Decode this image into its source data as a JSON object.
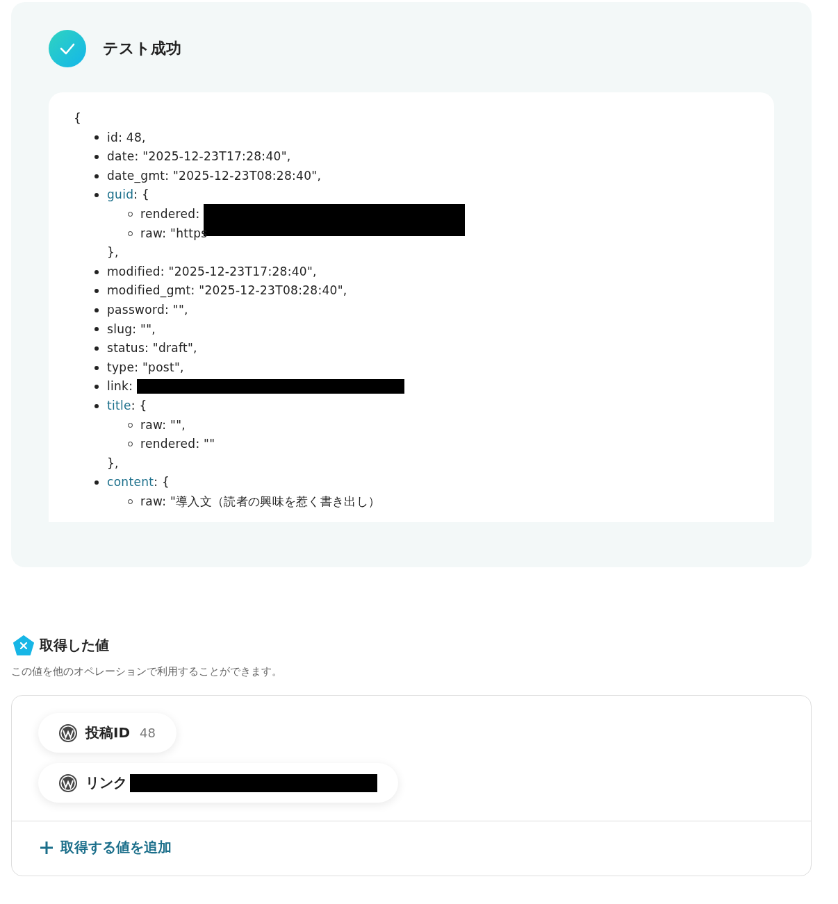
{
  "test_result": {
    "title": "テスト成功",
    "response": {
      "open": "{",
      "items": [
        {
          "key": "id",
          "value": ": 48,"
        },
        {
          "key": "date",
          "value": ": \"2025-12-23T17:28:40\","
        },
        {
          "key": "date_gmt",
          "value": ": \"2025-12-23T08:28:40\","
        },
        {
          "key": "guid",
          "value": ": {",
          "kind": "object",
          "close": "},",
          "children": [
            {
              "key": "rendered",
              "value": ":",
              "redacted": true
            },
            {
              "key": "raw",
              "value": ": \"https"
            }
          ]
        },
        {
          "key": "modified",
          "value": ": \"2025-12-23T17:28:40\","
        },
        {
          "key": "modified_gmt",
          "value": ": \"2025-12-23T08:28:40\","
        },
        {
          "key": "password",
          "value": ": \"\","
        },
        {
          "key": "slug",
          "value": ": \"\","
        },
        {
          "key": "status",
          "value": ": \"draft\","
        },
        {
          "key": "type",
          "value": ": \"post\","
        },
        {
          "key": "link",
          "value": ":",
          "redacted": true
        },
        {
          "key": "title",
          "value": ": {",
          "kind": "object",
          "close": "},",
          "children": [
            {
              "key": "raw",
              "value": ": \"\","
            },
            {
              "key": "rendered",
              "value": ": \"\""
            }
          ]
        },
        {
          "key": "content",
          "value": ": {",
          "kind": "object",
          "children": [
            {
              "key": "raw",
              "value": ": \"導入文（読者の興味を惹く書き出し）"
            }
          ]
        }
      ]
    }
  },
  "values_section": {
    "title": "取得した値",
    "description": "この値を他のオペレーションで利用することができます。",
    "values": [
      {
        "label": "投稿ID",
        "value": "48",
        "redacted": false
      },
      {
        "label": "リンク",
        "redacted": true
      }
    ],
    "add_button": "取得する値を追加"
  }
}
